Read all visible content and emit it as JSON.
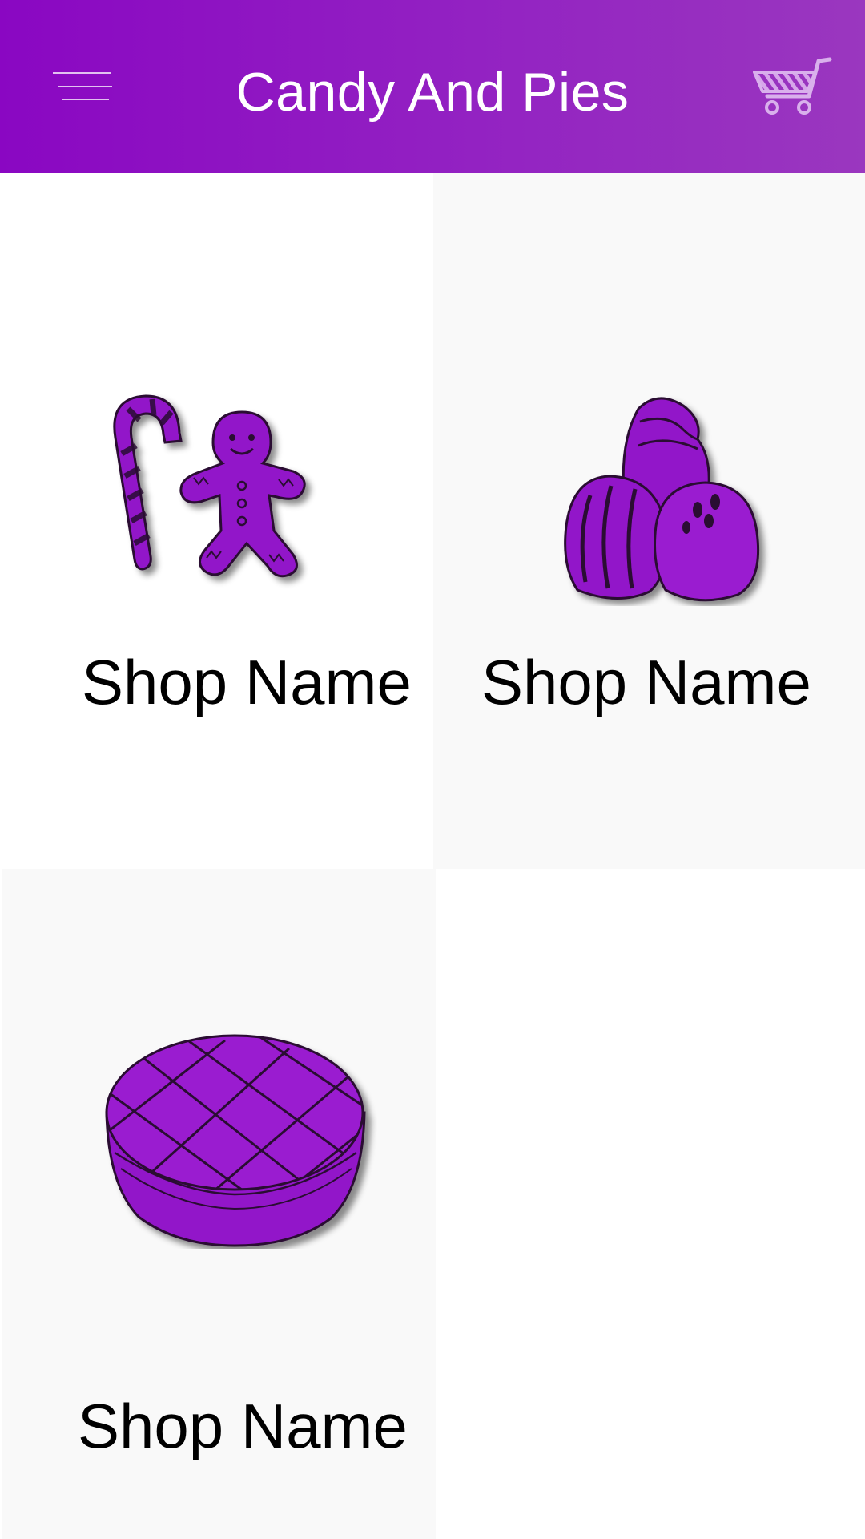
{
  "app_bar": {
    "title": "Candy And Pies",
    "menu_icon": "menu-icon",
    "cart_icon": "shopping-cart-icon",
    "gradient_start": "#8a07c2",
    "gradient_end": "#9a37bf"
  },
  "shops": [
    {
      "name": "Shop Name",
      "image": "candy-cane-gingerbread-icon"
    },
    {
      "name": "Shop Name",
      "image": "chocolate-truffles-icon"
    },
    {
      "name": "Shop Name",
      "image": "lattice-pie-icon"
    }
  ],
  "colors": {
    "accent": "#8a07c2",
    "item_fill": "#9215c9",
    "tile_grey": "#f9f9f9"
  }
}
